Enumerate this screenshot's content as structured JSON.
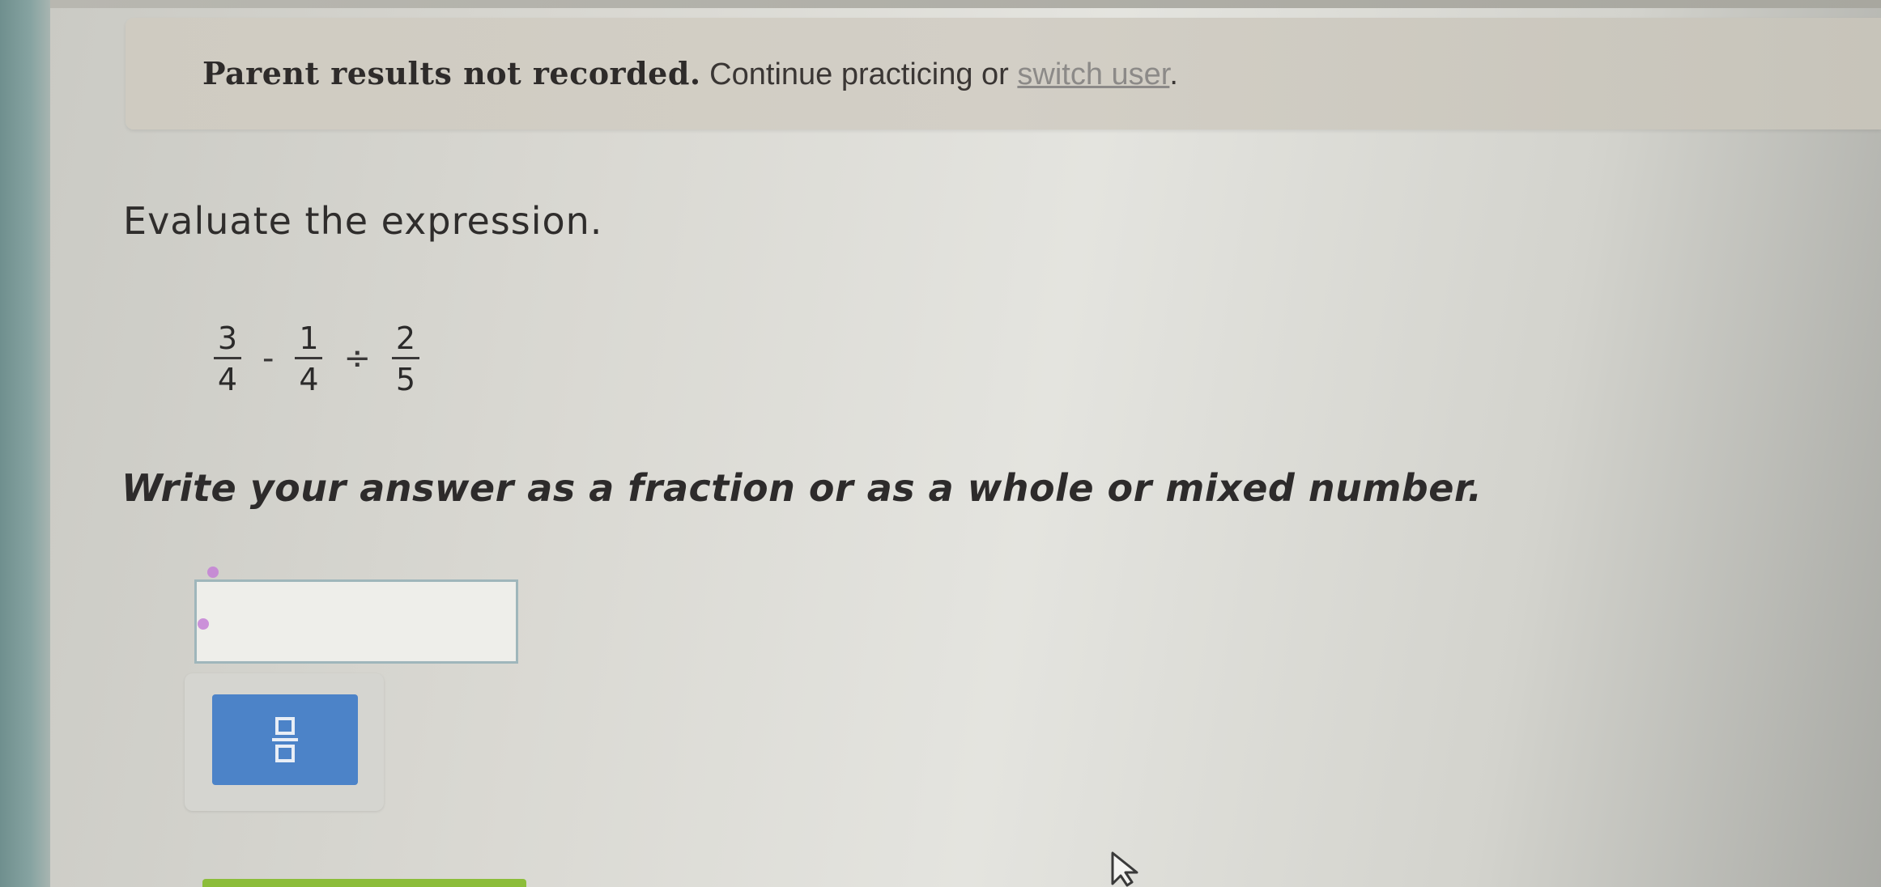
{
  "banner": {
    "bold_text": "Parent results not recorded.",
    "continue_text": " Continue practicing or ",
    "link_text": "switch user",
    "period": "."
  },
  "question": {
    "instruction": "Evaluate the expression.",
    "expression": {
      "fraction1": {
        "numerator": "3",
        "denominator": "4"
      },
      "operator1": "-",
      "fraction2": {
        "numerator": "1",
        "denominator": "4"
      },
      "operator2": "÷",
      "fraction3": {
        "numerator": "2",
        "denominator": "5"
      }
    },
    "answer_instruction": "Write your answer as a fraction or as a whole or mixed number."
  },
  "answer": {
    "value": ""
  },
  "toolbar": {
    "fraction_button_icon": "fraction-template-icon"
  },
  "colors": {
    "button_blue": "#4c83c8",
    "input_border": "#9fb6bb",
    "cursor_purple": "#c480d6",
    "accent_green": "#8cbd3a"
  }
}
